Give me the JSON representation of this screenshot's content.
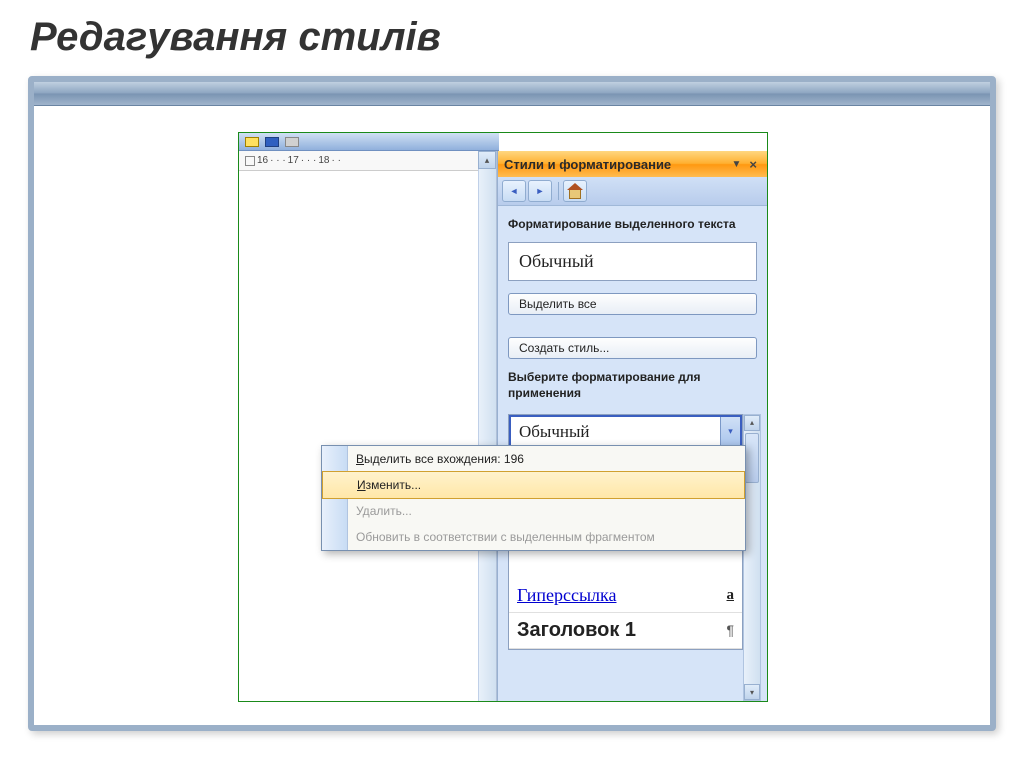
{
  "slide_title": "Редагування стилів",
  "ruler": {
    "n1": "16",
    "n2": "17",
    "n3": "18"
  },
  "taskpane": {
    "title": "Стили и форматирование",
    "section_current": "Форматирование выделенного текста",
    "current_style": "Обычный",
    "select_all": "Выделить все",
    "new_style": "Создать стиль...",
    "section_choose": "Выберите форматирование для применения",
    "styles": {
      "normal": "Обычный",
      "hyperlink": "Гиперссылка",
      "heading1": "Заголовок 1"
    }
  },
  "context_menu": {
    "select_occurrences": "Выделить все вхождения: 196",
    "modify": "Изменить...",
    "delete": "Удалить...",
    "update": "Обновить в соответствии с выделенным фрагментом"
  }
}
